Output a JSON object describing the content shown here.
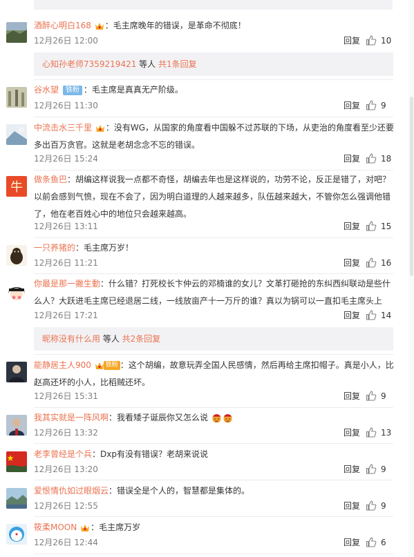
{
  "comments": [
    {
      "user": "酒醉心明白168",
      "text": "：毛主席晚年的错误，是革命不彻底！",
      "time": "12月26日 12:00",
      "reply": "回复",
      "likes": "10"
    },
    {
      "user": "谷水望",
      "badge": "铁粉",
      "text": "：毛主席是真真无产阶级。",
      "time": "12月26日 11:30",
      "reply": "回复",
      "likes": "9"
    },
    {
      "user": "中流击水三千里",
      "line1": "：没有WG，从国家的角度看中国躲不过苏联的下场，从吏治的角度看至少还要",
      "line2": "多出百万贪官。这就是老胡念念不忘的错误。",
      "time": "12月26日 15:24",
      "reply": "回复",
      "likes": "18"
    },
    {
      "user": "做条鱼巴",
      "line1": "：胡编这样说我一点都不奇怪，胡编去年也是这样说的，功劳不论，反正是错了，对吧？",
      "line2": "以前会感到气愤，现在不会了，因为明白道理的人越来越多，队伍越来越大，不管你怎么强调他错",
      "line3": "了，他在老百姓心中的地位只会越来越高。",
      "time": "12月26日 13:11",
      "reply": "回复",
      "likes": "15"
    },
    {
      "user": "一只养猪的",
      "text": "：毛主席万岁！",
      "time": "12月26日 11:21",
      "reply": "回复",
      "likes": "16"
    },
    {
      "user": "你最是那一撇生動",
      "line1": "：什么错？打死校长卞仲云的邓楠谁的女儿？文革打砸抢的东纠西纠联动是些什",
      "line2": "么人？大跃进毛主席已经退居二线，一线放亩产十一万斤的谁？真以为锅可以一直扣毛主席头上",
      "time": "12月26日 17:21",
      "reply": "回复",
      "likes": "14"
    },
    {
      "user": "能静居主人900",
      "badge": "铁粉",
      "line1": "：这个胡编，故意玩弄全国人民感情，然后再给主席扣帽子。真是小人，比",
      "line2": "赵高还坏的小人，比稻贼还坏。",
      "time": "12月26日 15:31",
      "reply": "回复",
      "likes": "9"
    },
    {
      "user": "我其实就是一阵风啊",
      "text": "：我看矮子诞辰你又怎么说",
      "time": "12月26日 13:32",
      "reply": "回复",
      "likes": "13"
    },
    {
      "user": "老李曾经是个兵",
      "text": "：Dxp有没有错误？老胡来说说",
      "time": "12月26日 13:20",
      "reply": "回复",
      "likes": "9"
    },
    {
      "user": "爱恨情仇如过眼烟云",
      "text": "：错误全是个人的，智慧都是集体的。",
      "time": "12月26日 12:55",
      "reply": "回复",
      "likes": "9"
    },
    {
      "user": "筱柔MOON",
      "text": "：毛主席万岁",
      "time": "12月26日 12:44",
      "reply": "回复",
      "likes": "6"
    }
  ],
  "subreplies": [
    {
      "user": "心知孙老师7359219421",
      "mid": " 等人 ",
      "count": "共1条回复"
    },
    {
      "user": "昵称没有什么用",
      "mid": " 等人 ",
      "count": "共2条回复"
    }
  ],
  "icons": {
    "like": "thumbs-up-icon",
    "verified": "crown-vip-icon",
    "emoji": "angry-face-emoji"
  },
  "colors": {
    "username": "#eb7350",
    "badge_fan": "#7cb8e8",
    "subreply_bg": "#f2f2f5"
  }
}
